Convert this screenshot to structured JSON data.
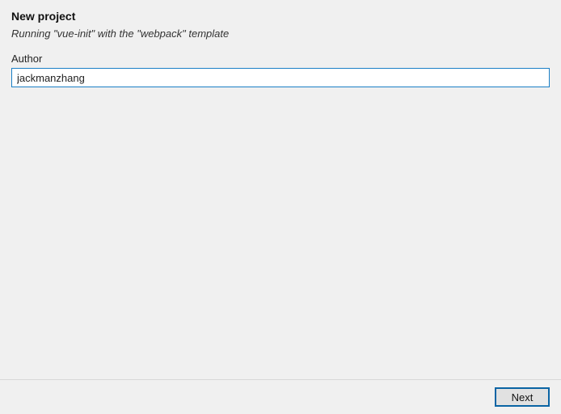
{
  "header": {
    "title": "New project",
    "subtitle": "Running \"vue-init\" with the \"webpack\" template"
  },
  "form": {
    "author_label": "Author",
    "author_value": "jackmanzhang"
  },
  "footer": {
    "next_label": "Next"
  }
}
